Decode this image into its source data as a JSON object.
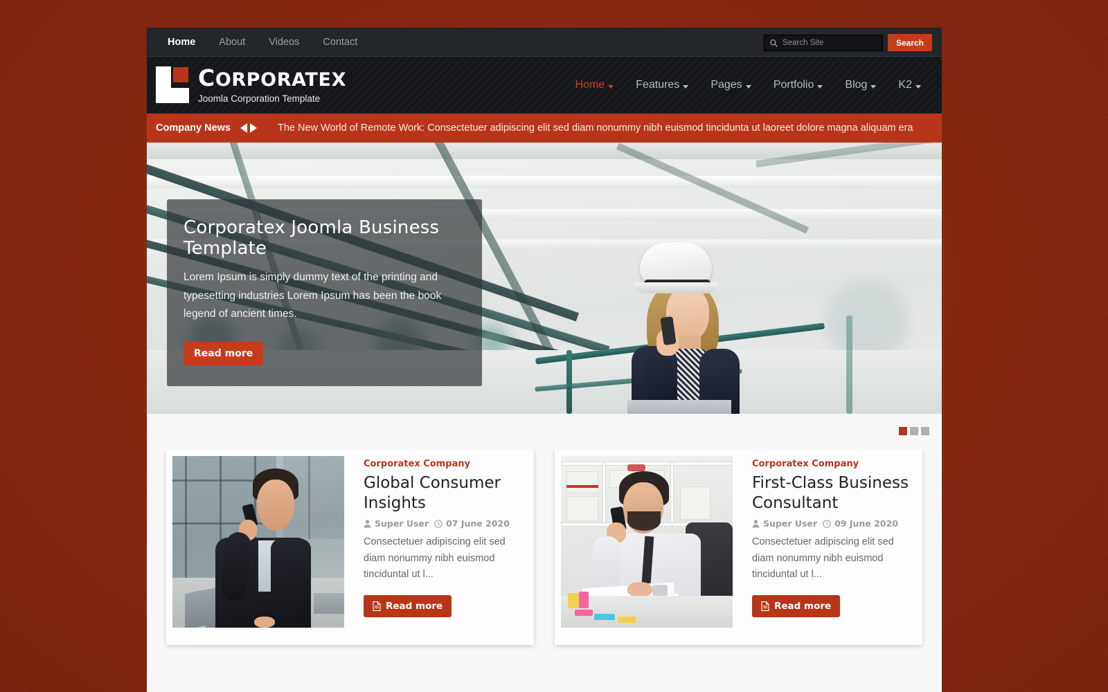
{
  "topbar": {
    "nav": [
      {
        "label": "Home",
        "active": true
      },
      {
        "label": "About",
        "active": false
      },
      {
        "label": "Videos",
        "active": false
      },
      {
        "label": "Contact",
        "active": false
      }
    ],
    "search": {
      "placeholder": "Search Site",
      "value": "",
      "button_label": "Search",
      "icon": "search-icon"
    }
  },
  "header": {
    "logo": {
      "icon": "corporatex-logo-mark",
      "accent_color": "#b8351a"
    },
    "brand_name": "Corporatex",
    "brand_name_cap": "C",
    "brand_name_rest": "ORPORATEX",
    "tagline": "Joomla Corporation Template",
    "nav": [
      {
        "label": "Home",
        "caret": true,
        "active": true
      },
      {
        "label": "Features",
        "caret": true,
        "active": false
      },
      {
        "label": "Pages",
        "caret": true,
        "active": false
      },
      {
        "label": "Portfolio",
        "caret": true,
        "active": false
      },
      {
        "label": "Blog",
        "caret": true,
        "active": false
      },
      {
        "label": "K2",
        "caret": true,
        "active": false
      }
    ]
  },
  "ticker": {
    "label": "Company News",
    "prev_icon": "triangle-left-icon",
    "next_icon": "triangle-right-icon",
    "headline": "The New World of Remote Work: Consectetuer adipiscing elit sed diam nonummy nibh euismod tincidunta ut laoreet dolore magna aliquam era"
  },
  "hero": {
    "title": "Corporatex Joomla Business Template",
    "text": "Lorem Ipsum is simply dummy text of the printing and typesetting industries Lorem Ipsum has been the book legend of ancient times.",
    "button_label": "Read more",
    "image_alt": "Woman in white hard hat talking on a mobile phone inside an industrial facility"
  },
  "pager": {
    "dots": [
      {
        "active": true
      },
      {
        "active": false
      },
      {
        "active": false
      }
    ]
  },
  "cards": [
    {
      "kicker": "Corporatex Company",
      "title": "Global Consumer Insights",
      "author_icon": "user-icon",
      "author": "Super User",
      "date_icon": "clock-icon",
      "date": "07 June 2020",
      "intro": "Consectetuer adipiscing elit sed diam nonummy nibh euismod tinciduntal ut l...",
      "button_icon": "document-icon",
      "button_label": "Read more",
      "image_alt": "Businessman in a dark suit speaking on a mobile phone outside a glass office building"
    },
    {
      "kicker": "Corporatex Company",
      "title": "First-Class Business Consultant",
      "author_icon": "user-icon",
      "author": "Super User",
      "date_icon": "clock-icon",
      "date": "09 June 2020",
      "intro": "Consectetuer adipiscing elit sed diam nonummy nibh euismod tinciduntal ut l...",
      "button_icon": "document-icon",
      "button_label": "Read more",
      "image_alt": "Man in a white shirt and tie on the phone reviewing paperwork at an office desk"
    }
  ],
  "colors": {
    "page_background": "#8e2b14",
    "accent": "#b8351a",
    "accent_bright": "#c63c1b",
    "topbar": "#23262a",
    "header": "#14171a",
    "content_background": "#f7f7f7"
  }
}
